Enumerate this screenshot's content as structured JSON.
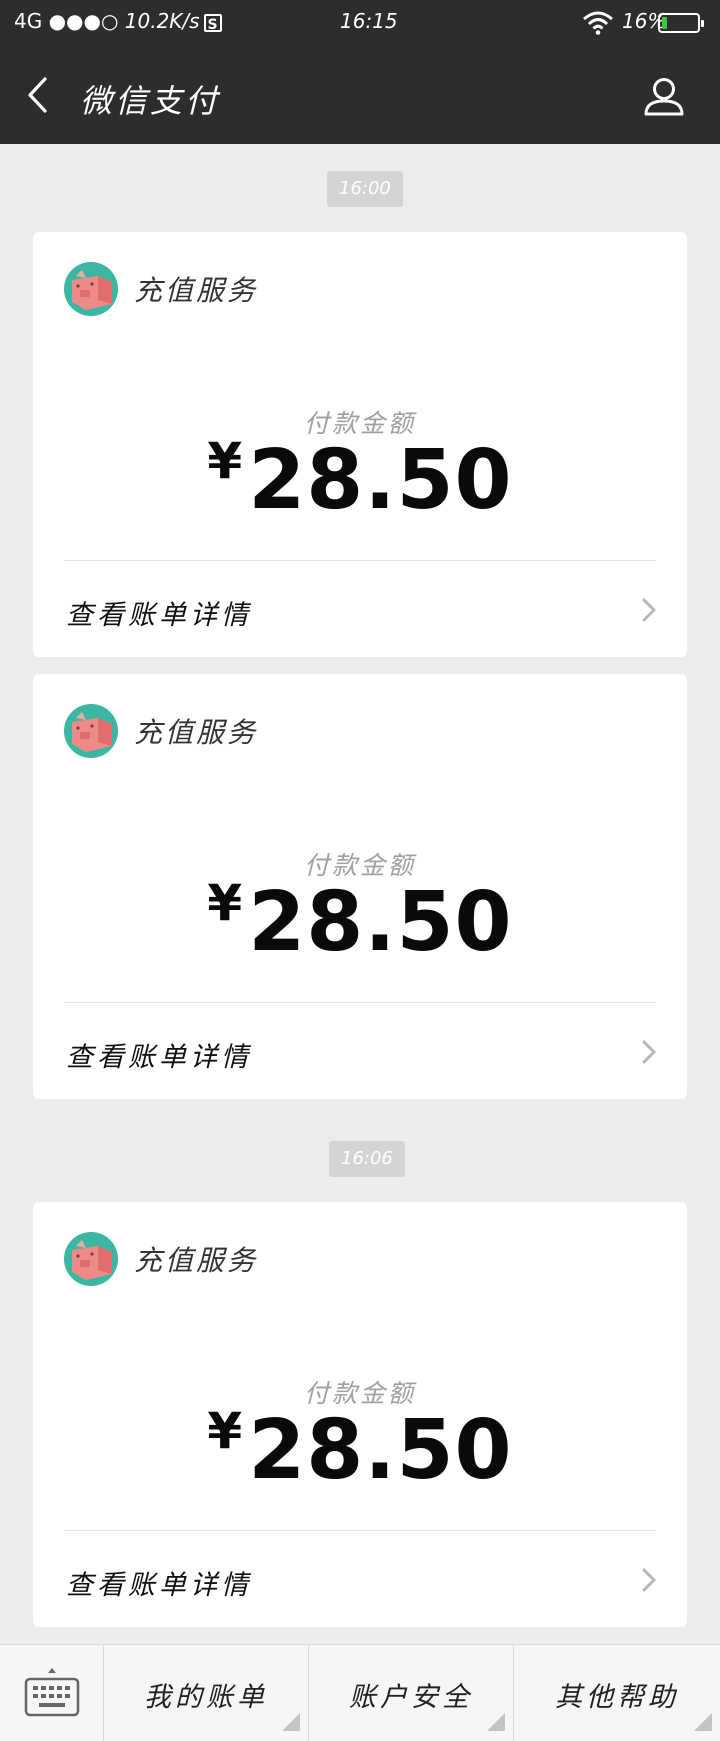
{
  "status_bar": {
    "network": "4G",
    "signal": "●●●○",
    "speed": "10.2K/s",
    "s_badge": "S",
    "time": "16:15",
    "battery_text": "16%",
    "battery_level": 0.16,
    "battery_color": "#3ec63e"
  },
  "header": {
    "title": "微信支付",
    "back_icon": "chevron-left-icon",
    "profile_icon": "person-icon"
  },
  "timestamps": [
    "16:00",
    "16:06"
  ],
  "cards": [
    {
      "merchant": "充值服务",
      "amount_label": "付款金额",
      "currency": "¥",
      "amount": "28.50",
      "detail_link": "查看账单详情"
    },
    {
      "merchant": "充值服务",
      "amount_label": "付款金额",
      "currency": "¥",
      "amount": "28.50",
      "detail_link": "查看账单详情"
    },
    {
      "merchant": "充值服务",
      "amount_label": "付款金额",
      "currency": "¥",
      "amount": "28.50",
      "detail_link": "查看账单详情"
    }
  ],
  "bottom_menu": {
    "keyboard_icon": "keyboard-icon",
    "items": [
      "我的账单",
      "账户安全",
      "其他帮助"
    ]
  },
  "colors": {
    "header_bg": "#2d2d2f",
    "page_bg": "#eeebef",
    "avatar_bg": "#3bb6a0",
    "avatar_pig": "#f08a8a"
  }
}
